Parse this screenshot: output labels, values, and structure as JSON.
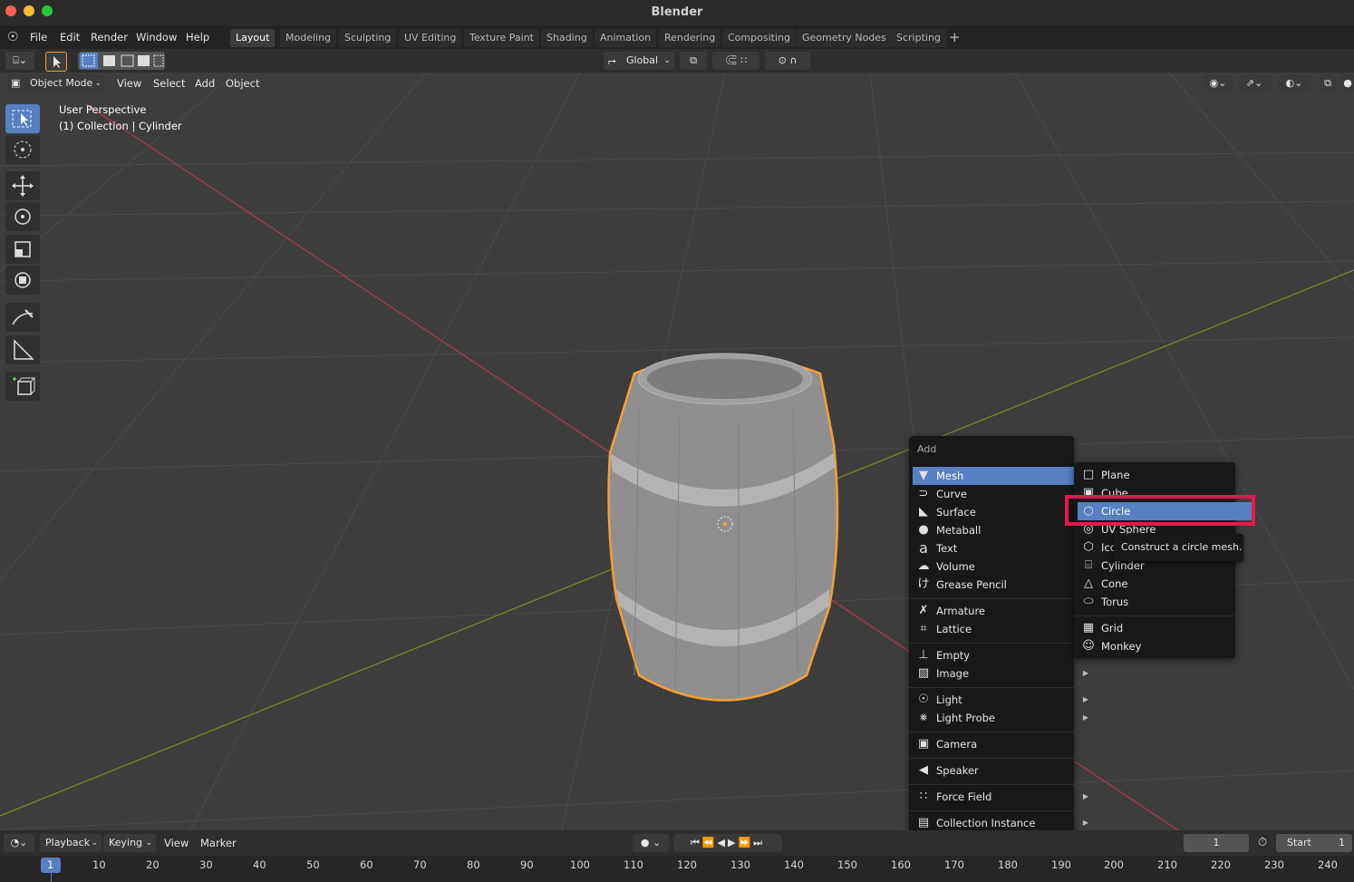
{
  "app": {
    "title": "Blender"
  },
  "menubar": {
    "items": [
      "File",
      "Edit",
      "Render",
      "Window",
      "Help"
    ]
  },
  "workspaces": [
    "Layout",
    "Modeling",
    "Sculpting",
    "UV Editing",
    "Texture Paint",
    "Shading",
    "Animation",
    "Rendering",
    "Compositing",
    "Geometry Nodes",
    "Scripting"
  ],
  "active_workspace": "Layout",
  "toolheader": {
    "transform_orientation": "Global"
  },
  "viewport_header": {
    "mode": "Object Mode",
    "menus": [
      "View",
      "Select",
      "Add",
      "Object"
    ]
  },
  "viewport": {
    "perspective": "User Perspective",
    "collection": "(1) Collection | Cylinder"
  },
  "add_menu": {
    "title": "Add",
    "items": [
      {
        "label": "Mesh",
        "icon": "mesh-icon",
        "submenu": true
      },
      {
        "label": "Curve",
        "icon": "curve-icon",
        "submenu": true
      },
      {
        "label": "Surface",
        "icon": "surface-icon",
        "submenu": true
      },
      {
        "label": "Metaball",
        "icon": "metaball-icon",
        "submenu": true
      },
      {
        "label": "Text",
        "icon": "text-icon",
        "submenu": false
      },
      {
        "label": "Volume",
        "icon": "volume-icon",
        "submenu": true
      },
      {
        "label": "Grease Pencil",
        "icon": "grease-pencil-icon",
        "submenu": true
      },
      {
        "label": "Armature",
        "icon": "armature-icon",
        "submenu": false
      },
      {
        "label": "Lattice",
        "icon": "lattice-icon",
        "submenu": false
      },
      {
        "label": "Empty",
        "icon": "empty-icon",
        "submenu": true
      },
      {
        "label": "Image",
        "icon": "image-icon",
        "submenu": true
      },
      {
        "label": "Light",
        "icon": "light-icon",
        "submenu": true
      },
      {
        "label": "Light Probe",
        "icon": "light-probe-icon",
        "submenu": true
      },
      {
        "label": "Camera",
        "icon": "camera-icon",
        "submenu": false
      },
      {
        "label": "Speaker",
        "icon": "speaker-icon",
        "submenu": false
      },
      {
        "label": "Force Field",
        "icon": "force-field-icon",
        "submenu": true
      },
      {
        "label": "Collection Instance",
        "icon": "collection-instance-icon",
        "submenu": true
      }
    ]
  },
  "mesh_menu": {
    "items": [
      {
        "label": "Plane",
        "icon": "plane-icon"
      },
      {
        "label": "Cube",
        "icon": "cube-icon"
      },
      {
        "label": "Circle",
        "icon": "circle-icon"
      },
      {
        "label": "UV Sphere",
        "icon": "uv-sphere-icon"
      },
      {
        "label": "Ico Sphere",
        "icon": "ico-sphere-icon"
      },
      {
        "label": "Cylinder",
        "icon": "cylinder-icon"
      },
      {
        "label": "Cone",
        "icon": "cone-icon"
      },
      {
        "label": "Torus",
        "icon": "torus-icon"
      },
      {
        "label": "Grid",
        "icon": "grid-icon"
      },
      {
        "label": "Monkey",
        "icon": "monkey-icon"
      }
    ],
    "highlighted": "Circle"
  },
  "tooltip": "Construct a circle mesh.",
  "timeline": {
    "menus": [
      "Playback",
      "Keying",
      "View",
      "Marker"
    ],
    "current_frame": "1",
    "start_label": "Start",
    "start_value": "1",
    "ruler": [
      "1",
      "10",
      "20",
      "30",
      "40",
      "50",
      "60",
      "70",
      "80",
      "90",
      "100",
      "110",
      "120",
      "130",
      "140",
      "150",
      "160",
      "170",
      "180",
      "190",
      "200",
      "210",
      "220",
      "230",
      "240"
    ]
  },
  "colors": {
    "accent": "#5680c2",
    "highlight_box": "#e8174f",
    "selection_outline": "#f5a031",
    "x_axis": "#a63d45",
    "y_axis": "#6f8c2a"
  }
}
